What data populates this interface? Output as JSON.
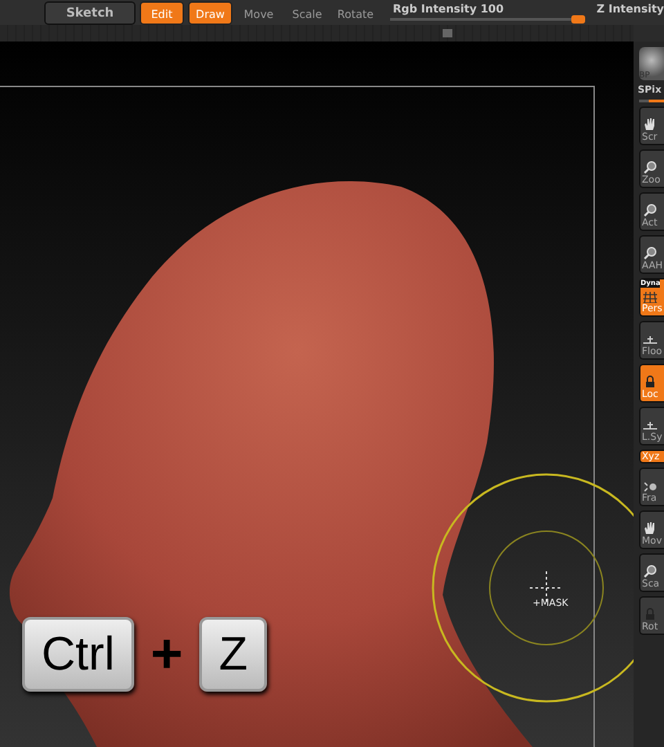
{
  "top_toolbar": {
    "buttons": [
      {
        "label": "Sketch",
        "kind": "large",
        "selected": false
      },
      {
        "label": "Edit",
        "kind": "tool",
        "selected": true
      },
      {
        "label": "Draw",
        "kind": "tool",
        "selected": true
      },
      {
        "label": "Move",
        "kind": "tool",
        "selected": false
      },
      {
        "label": "Scale",
        "kind": "tool",
        "selected": false
      },
      {
        "label": "Rotate",
        "kind": "tool",
        "selected": false
      }
    ],
    "rgb_intensity": {
      "label": "Rgb Intensity 100",
      "level": 0.97
    },
    "z_intensity": {
      "label": "Z Intensity"
    }
  },
  "right_shelf": {
    "bpr_label": "BP",
    "spix": {
      "label": "SPix",
      "level": 0.6
    },
    "buttons": [
      {
        "label": "Scr",
        "kind": "hand",
        "selected": false
      },
      {
        "label": "Zoo",
        "kind": "zoom",
        "selected": false
      },
      {
        "label": "Act",
        "kind": "zoom",
        "selected": false
      },
      {
        "label": "AAH",
        "kind": "zoom",
        "selected": false
      },
      {
        "label": "Pers",
        "tag": "Dyna",
        "kind": "grid",
        "selected": true
      },
      {
        "label": "Floo",
        "kind": "floor",
        "selected": false
      },
      {
        "label": "Loc",
        "kind": "lock",
        "selected": true
      },
      {
        "label": "L.Sy",
        "kind": "floor",
        "selected": false
      },
      {
        "label": "Xyz",
        "kind": "small",
        "selected": true
      },
      {
        "label": "Fra",
        "kind": "frame",
        "selected": false
      },
      {
        "label": "Mov",
        "kind": "hand",
        "selected": false
      },
      {
        "label": "Sca",
        "kind": "zoom",
        "selected": false
      },
      {
        "label": "Rot",
        "kind": "lock",
        "selected": false
      }
    ]
  },
  "viewport": {
    "brush_mode": "+MASK",
    "shortcut": {
      "keys": [
        "Ctrl",
        "Z"
      ],
      "joiner": "+"
    }
  }
}
